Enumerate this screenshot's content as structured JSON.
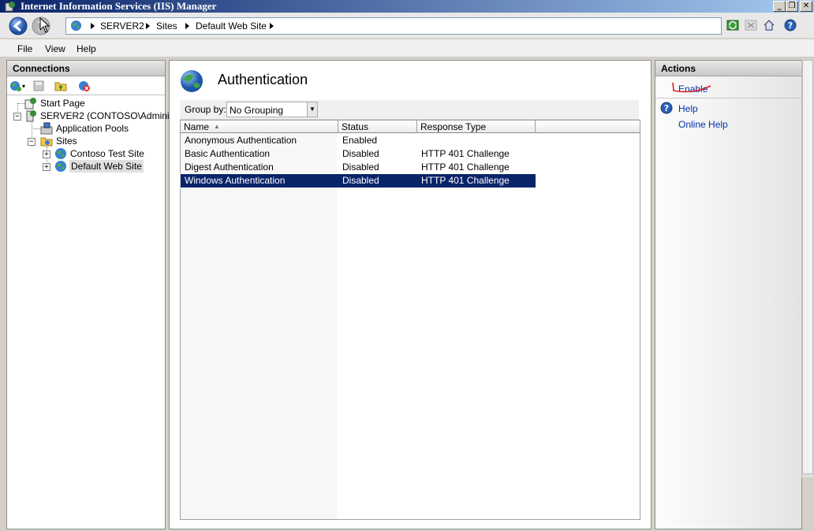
{
  "window": {
    "title": "Internet Information Services (IIS) Manager"
  },
  "breadcrumb": [
    "SERVER2",
    "Sites",
    "Default Web Site"
  ],
  "menu": [
    "File",
    "View",
    "Help"
  ],
  "connections": {
    "title": "Connections",
    "tree": {
      "start_page": "Start Page",
      "server": "SERVER2 (CONTOSO\\Administra",
      "app_pools": "Application Pools",
      "sites": "Sites",
      "site1": "Contoso Test Site",
      "site2": "Default Web Site"
    }
  },
  "main": {
    "title": "Authentication",
    "group_by_label": "Group by:",
    "group_by_value": "No Grouping",
    "columns": [
      "Name",
      "Status",
      "Response Type"
    ],
    "rows": [
      {
        "name": "Anonymous Authentication",
        "status": "Enabled",
        "response": ""
      },
      {
        "name": "Basic Authentication",
        "status": "Disabled",
        "response": "HTTP 401 Challenge"
      },
      {
        "name": "Digest Authentication",
        "status": "Disabled",
        "response": "HTTP 401 Challenge"
      },
      {
        "name": "Windows Authentication",
        "status": "Disabled",
        "response": "HTTP 401 Challenge"
      }
    ],
    "selected_row": 3
  },
  "actions": {
    "title": "Actions",
    "enable": "Enable",
    "help": "Help",
    "online_help": "Online Help"
  },
  "colors": {
    "selection": "#0a246a",
    "link": "#0033aa",
    "annotation": "#e02020"
  }
}
